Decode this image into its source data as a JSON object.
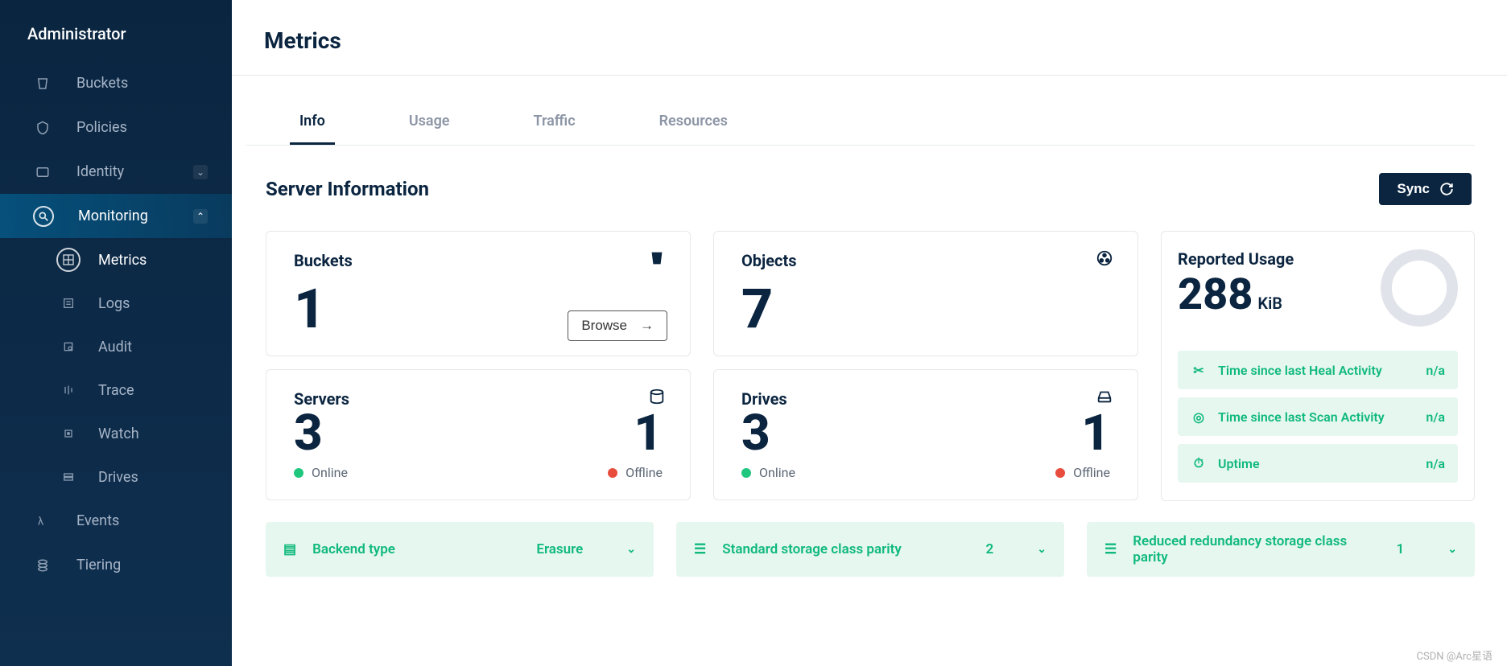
{
  "sidebar": {
    "title": "Administrator",
    "items": [
      {
        "label": "Buckets",
        "icon": "bucket-icon"
      },
      {
        "label": "Policies",
        "icon": "shield-icon"
      },
      {
        "label": "Identity",
        "icon": "id-icon",
        "expandable": true
      },
      {
        "label": "Monitoring",
        "icon": "magnify-icon",
        "active": true,
        "expanded": true
      },
      {
        "label": "Events",
        "icon": "lambda-icon"
      },
      {
        "label": "Tiering",
        "icon": "tiering-icon"
      }
    ],
    "monitoring_children": [
      {
        "label": "Metrics",
        "icon": "metrics-icon",
        "active": true
      },
      {
        "label": "Logs",
        "icon": "logs-icon"
      },
      {
        "label": "Audit",
        "icon": "audit-icon"
      },
      {
        "label": "Trace",
        "icon": "trace-icon"
      },
      {
        "label": "Watch",
        "icon": "watch-icon"
      },
      {
        "label": "Drives",
        "icon": "drives-icon"
      }
    ]
  },
  "header": {
    "title": "Metrics"
  },
  "tabs": {
    "items": [
      "Info",
      "Usage",
      "Traffic",
      "Resources"
    ],
    "active": "Info"
  },
  "section": {
    "title": "Server Information",
    "sync_label": "Sync"
  },
  "cards": {
    "buckets": {
      "title": "Buckets",
      "value": "1",
      "browse_label": "Browse"
    },
    "objects": {
      "title": "Objects",
      "value": "7"
    },
    "servers": {
      "title": "Servers",
      "online": "3",
      "online_label": "Online",
      "offline": "1",
      "offline_label": "Offline"
    },
    "drives": {
      "title": "Drives",
      "online": "3",
      "online_label": "Online",
      "offline": "1",
      "offline_label": "Offline"
    }
  },
  "usage": {
    "title": "Reported Usage",
    "value": "288",
    "unit": "KiB",
    "activities": [
      {
        "icon": "heal-icon",
        "label": "Time since last Heal Activity",
        "value": "n/a"
      },
      {
        "icon": "scan-icon",
        "label": "Time since last Scan Activity",
        "value": "n/a"
      },
      {
        "icon": "uptime-icon",
        "label": "Uptime",
        "value": "n/a"
      }
    ]
  },
  "footer": [
    {
      "icon": "backend-icon",
      "label": "Backend type",
      "value": "Erasure"
    },
    {
      "icon": "storage-icon",
      "label": "Standard storage class parity",
      "value": "2"
    },
    {
      "icon": "storage-icon",
      "label": "Reduced redundancy storage class parity",
      "value": "1"
    }
  ],
  "watermark": "CSDN @Arc星语"
}
